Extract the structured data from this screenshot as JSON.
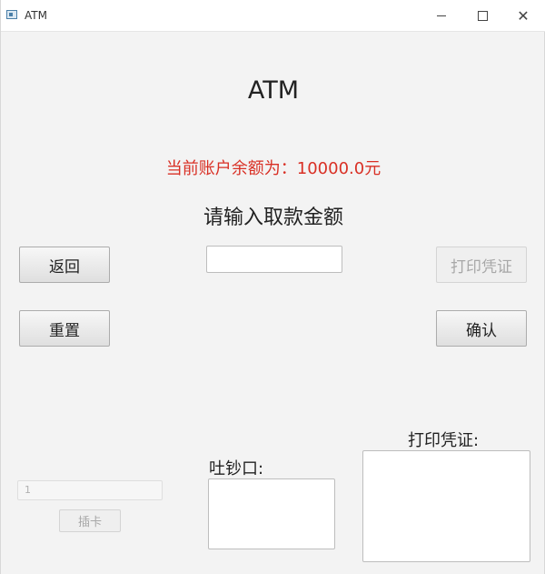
{
  "window": {
    "title": "ATM",
    "controls": [
      "minimize-icon",
      "maximize-icon",
      "close-icon"
    ]
  },
  "main": {
    "heading": "ATM",
    "balance_text": "当前账户余额为：10000.0元",
    "balance_color": "#d93025",
    "prompt": "请输入取款金额",
    "amount_input_value": ""
  },
  "buttons": {
    "back": "返回",
    "reset": "重置",
    "print_receipt": "打印凭证",
    "confirm": "确认",
    "insert_card": "插卡"
  },
  "bottom": {
    "card_input_value": "1",
    "cash_slot_label": "吐钞口:",
    "receipt_label": "打印凭证:",
    "cash_slot_text": "",
    "receipt_text": ""
  }
}
